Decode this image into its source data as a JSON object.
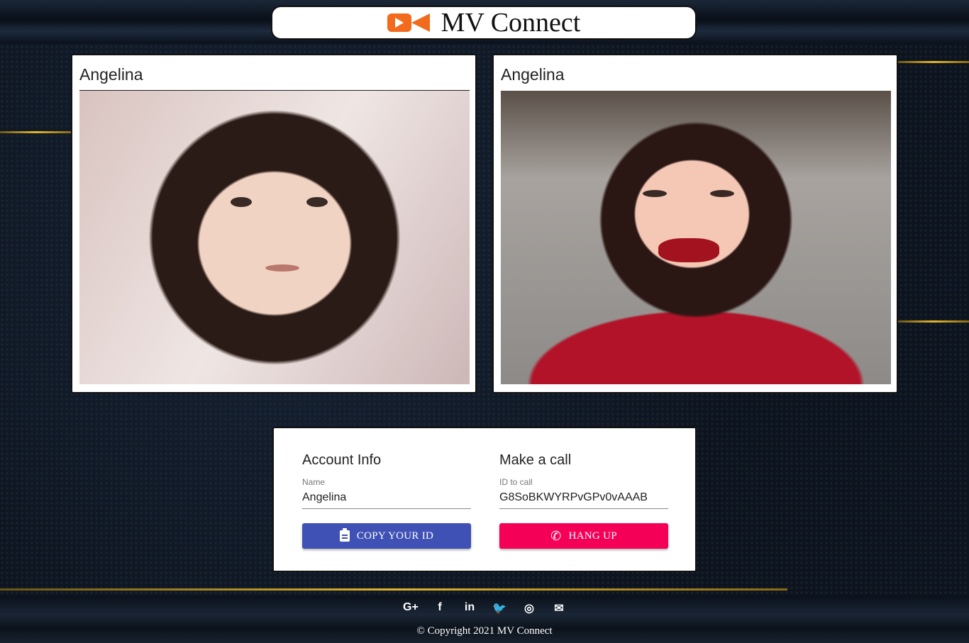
{
  "header": {
    "title": "MV Connect",
    "logo_icon": "video-camera-icon"
  },
  "videos": [
    {
      "name": "Angelina"
    },
    {
      "name": "Angelina"
    }
  ],
  "account": {
    "title": "Account Info",
    "name_label": "Name",
    "name_value": "Angelina",
    "copy_button": "COPY YOUR ID"
  },
  "call": {
    "title": "Make a call",
    "id_label": "ID to call",
    "id_value": "G8SoBKWYRPvGPv0vAAAB",
    "hangup_button": "HANG UP"
  },
  "social": [
    {
      "icon": "google-plus-icon",
      "glyph": "G+"
    },
    {
      "icon": "facebook-icon",
      "glyph": "f"
    },
    {
      "icon": "linkedin-icon",
      "glyph": "in"
    },
    {
      "icon": "twitter-icon",
      "glyph": "🐦"
    },
    {
      "icon": "instagram-icon",
      "glyph": "◎"
    },
    {
      "icon": "email-icon",
      "glyph": "✉"
    }
  ],
  "footer": {
    "copyright": "© Copyright 2021 MV Connect"
  },
  "colors": {
    "copy_button": "#3f51b5",
    "hangup_button": "#f50057",
    "logo": "#f26b1d",
    "accent_gold": "#e3b52a"
  }
}
